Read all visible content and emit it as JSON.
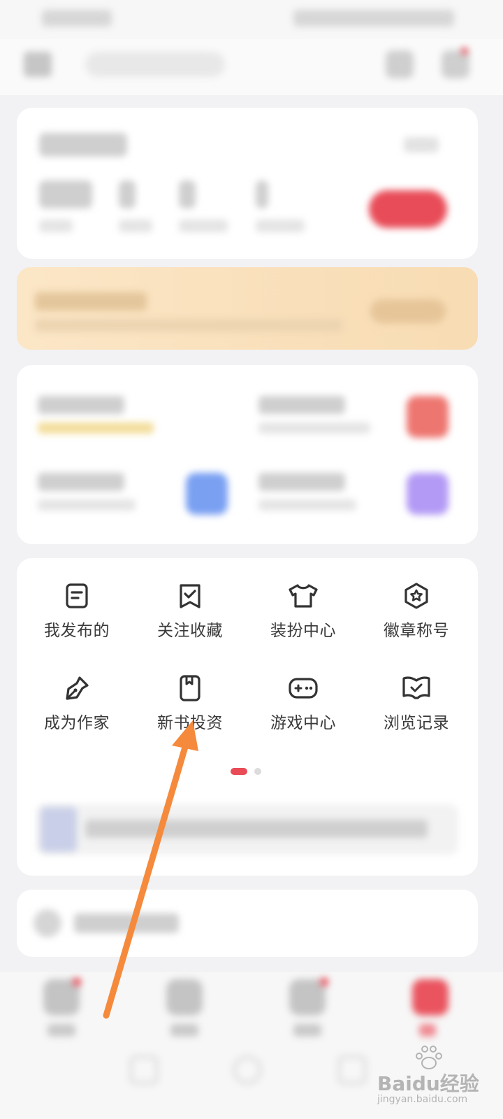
{
  "menu": {
    "items": [
      {
        "label": "我发布的",
        "icon": "document-icon"
      },
      {
        "label": "关注收藏",
        "icon": "bookmark-check-icon"
      },
      {
        "label": "装扮中心",
        "icon": "tshirt-icon"
      },
      {
        "label": "徽章称号",
        "icon": "badge-star-icon"
      },
      {
        "label": "成为作家",
        "icon": "pen-nib-icon"
      },
      {
        "label": "新书投资",
        "icon": "book-icon"
      },
      {
        "label": "游戏中心",
        "icon": "gamepad-icon"
      },
      {
        "label": "浏览记录",
        "icon": "history-book-icon"
      }
    ],
    "page_indicator": {
      "current": 1,
      "total": 2
    }
  },
  "annotation": {
    "arrow_color": "#f58a3c",
    "points_to": "新书投资"
  },
  "watermark": {
    "brand": "Baidu经验",
    "url": "jingyan.baidu.com"
  },
  "colors": {
    "accent": "#e94b57",
    "vip_gold": "#f8dcb3"
  }
}
